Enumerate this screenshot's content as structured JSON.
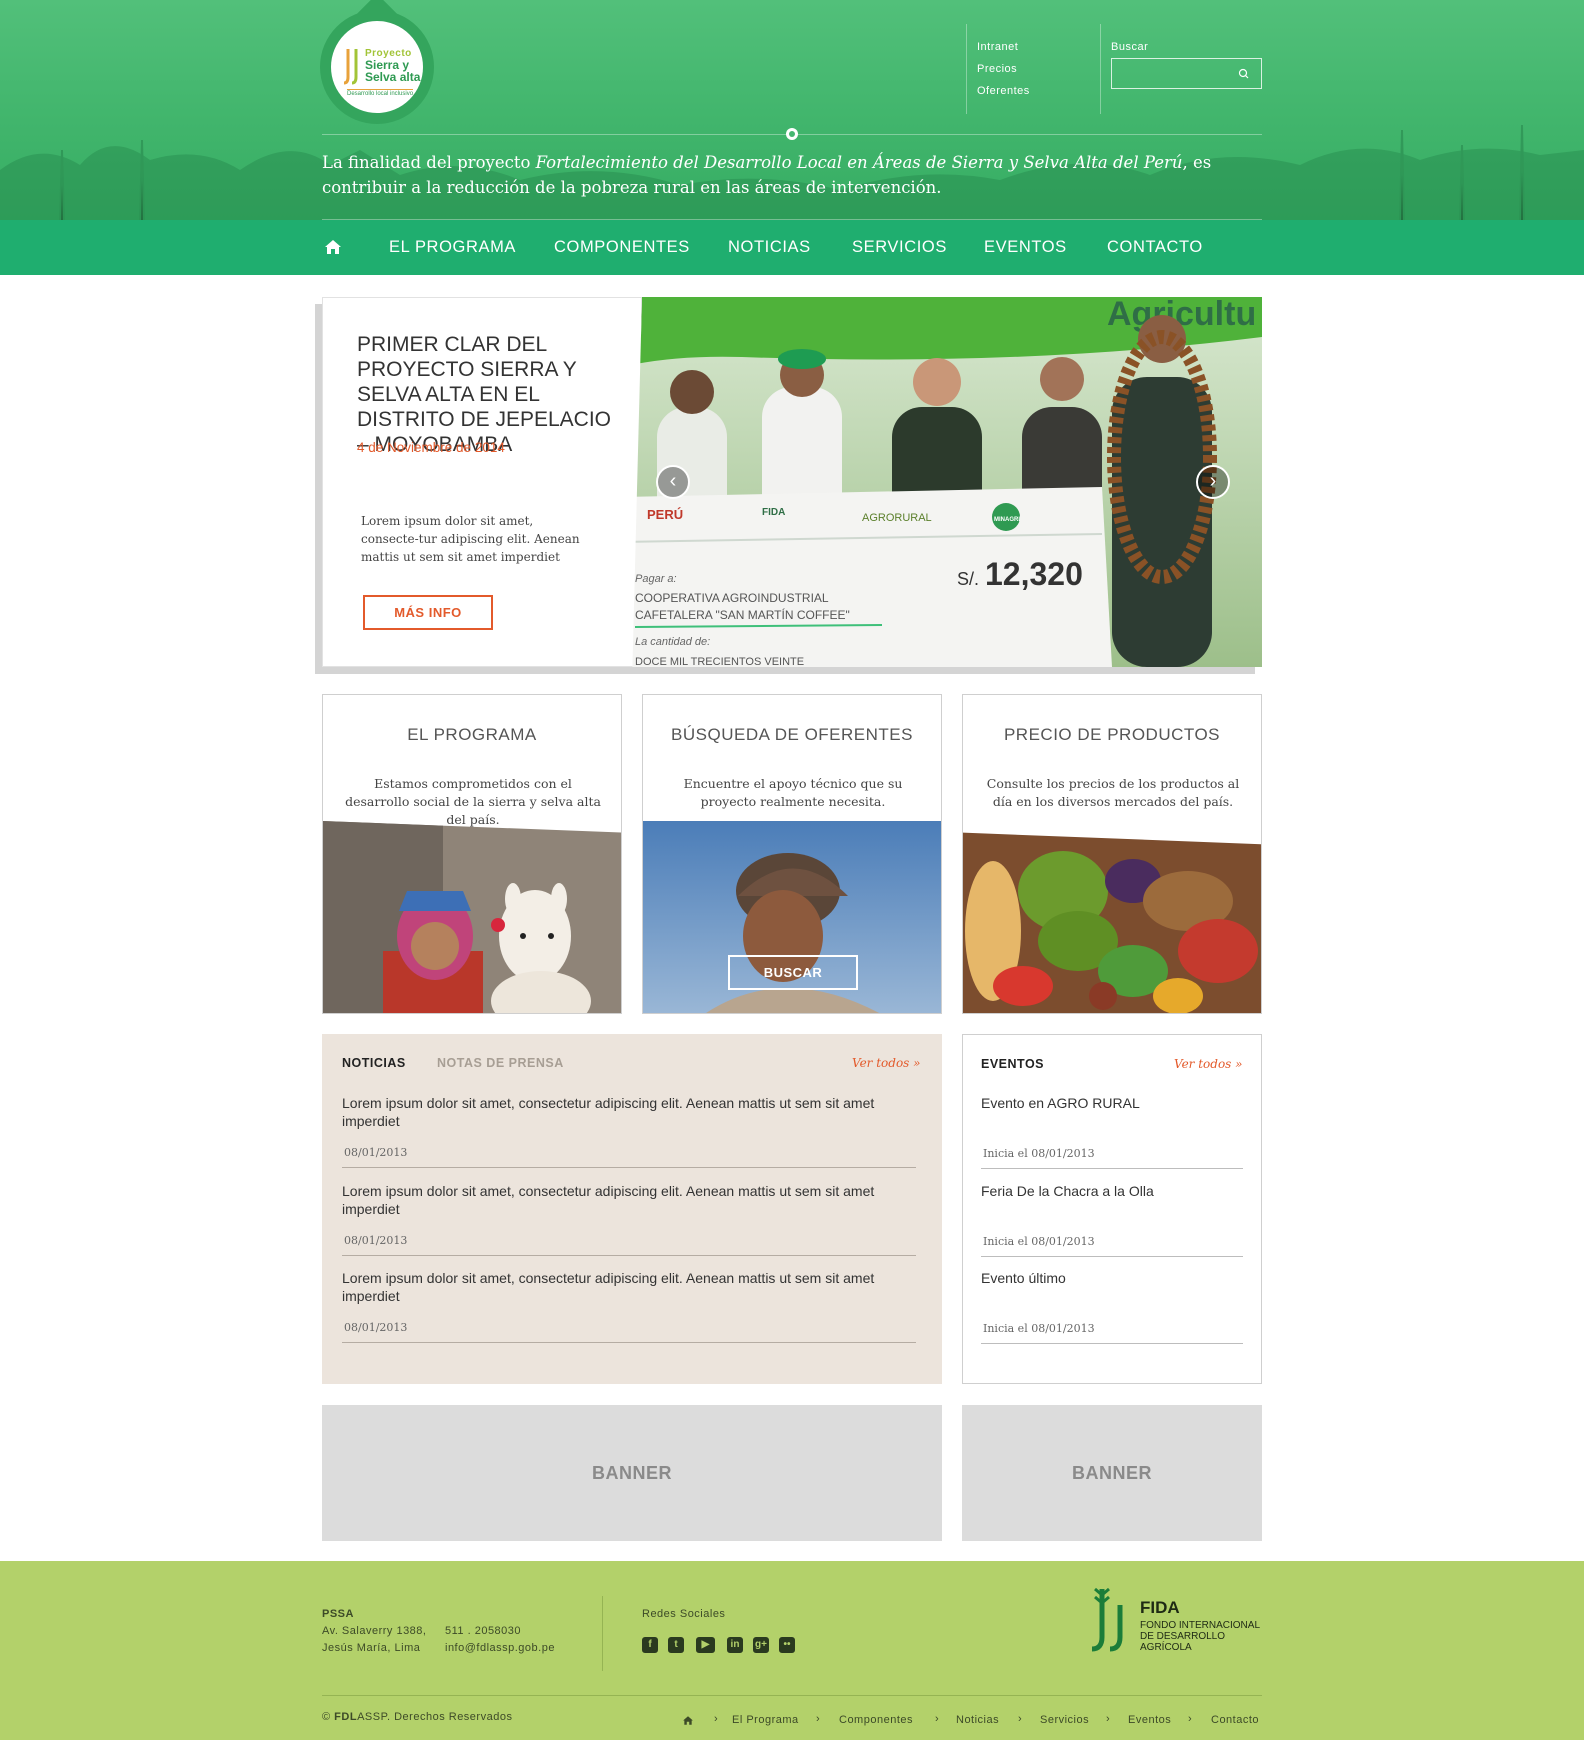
{
  "header": {
    "logo": {
      "line1": "Proyecto",
      "line2": "Sierra y",
      "line3": "Selva alta",
      "line4": "Desarrollo local inclusivo"
    },
    "top_links": [
      "Intranet",
      "Precios",
      "Oferentes"
    ],
    "search": {
      "label": "Buscar",
      "placeholder": ""
    },
    "tagline": {
      "pre": "La finalidad del proyecto ",
      "em": "Fortalecimiento del Desarrollo Local en Áreas de Sierra y Selva Alta del Perú",
      "post": ", es contribuir a la reducción de la pobreza rural en las áreas de intervención."
    }
  },
  "nav": {
    "items": [
      "EL PROGRAMA",
      "COMPONENTES",
      "NOTICIAS",
      "SERVICIOS",
      "EVENTOS",
      "CONTACTO"
    ]
  },
  "hero": {
    "title": "PRIMER CLAR DEL PROYECTO SIERRA Y SELVA ALTA EN EL DISTRITO DE JEPELACIO – MOYOBAMBA",
    "date": "4 de Noviembre de 2014",
    "text": "Lorem ipsum dolor sit amet, consecte-tur adipiscing elit. Aenean mattis ut sem sit amet imperdiet",
    "button": "MÁS INFO",
    "photo": {
      "sign": "Agricultu",
      "check_amount": "12,320",
      "check_currency": "S/.",
      "check_pay_label": "Pagar a:",
      "check_payee1": "COOPERATIVA AGROINDUSTRIAL",
      "check_payee2": "CAFETALERA \"SAN MARTÍN COFFEE\"",
      "check_qty_label": "La cantidad de:",
      "check_qty": "DOCE MIL TRECIENTOS VEINTE",
      "logo_peru": "PERÚ",
      "logo_fida": "FIDA",
      "logo_agro": "AGRORURAL",
      "logo_minagri": "MINAGRI"
    }
  },
  "features": [
    {
      "title": "EL PROGRAMA",
      "text": "Estamos comprometidos con el desarrollo social de la sierra y selva alta del país."
    },
    {
      "title": "BÚSQUEDA DE OFERENTES",
      "text": "Encuentre el apoyo técnico que su proyecto realmente necesita.",
      "button": "BUSCAR"
    },
    {
      "title": "PRECIO DE PRODUCTOS",
      "text": "Consulte los precios de los productos al día en los diversos mercados del país."
    }
  ],
  "news": {
    "tab_active": "NOTICIAS",
    "tab_inactive": "NOTAS DE PRENSA",
    "ver_todos": "Ver todos »",
    "items": [
      {
        "title": "Lorem ipsum dolor sit amet, consectetur adipiscing elit. Aenean mattis ut sem sit amet imperdiet",
        "date": "08/01/2013"
      },
      {
        "title": "Lorem ipsum dolor sit amet, consectetur adipiscing elit. Aenean mattis ut sem sit amet imperdiet",
        "date": "08/01/2013"
      },
      {
        "title": "Lorem ipsum dolor sit amet, consectetur adipiscing elit. Aenean mattis ut sem sit amet imperdiet",
        "date": "08/01/2013"
      }
    ]
  },
  "events": {
    "title": "EVENTOS",
    "ver_todos": "Ver todos »",
    "items": [
      {
        "title": "Evento en AGRO RURAL",
        "date": "Inicia el 08/01/2013"
      },
      {
        "title": "Feria De la Chacra a la Olla",
        "date": "Inicia el 08/01/2013"
      },
      {
        "title": "Evento último",
        "date": "Inicia el 08/01/2013"
      }
    ]
  },
  "banners": [
    "BANNER",
    "BANNER"
  ],
  "footer": {
    "org": "PSSA",
    "address1": "Av. Salaverry 1388,",
    "address2": "Jesús María, Lima",
    "phone": "511 . 2058030",
    "email": "info@fdlassp.gob.pe",
    "social_title": "Redes Sociales",
    "social_icons": [
      "facebook-icon",
      "twitter-icon",
      "youtube-icon",
      "linkedin-icon",
      "googleplus-icon",
      "flickr-icon"
    ],
    "fida": {
      "name": "FIDA",
      "line1": "FONDO INTERNACIONAL",
      "line2": "DE DESARROLLO",
      "line3": "AGRÍCOLA"
    },
    "copyright_pre": "© ",
    "copyright_brand": "FDL",
    "copyright_brand2": "ASSP",
    "copyright_post": ". Derechos Reservados",
    "crumbs": [
      "El Programa",
      "Componentes",
      "Noticias",
      "Servicios",
      "Eventos",
      "Contacto"
    ]
  },
  "colors": {
    "header_green": "#41b56c",
    "nav_green": "#1fae6f",
    "accent_orange": "#e35a2b",
    "news_bg": "#ece4dc",
    "footer_green": "#b3d16a"
  }
}
